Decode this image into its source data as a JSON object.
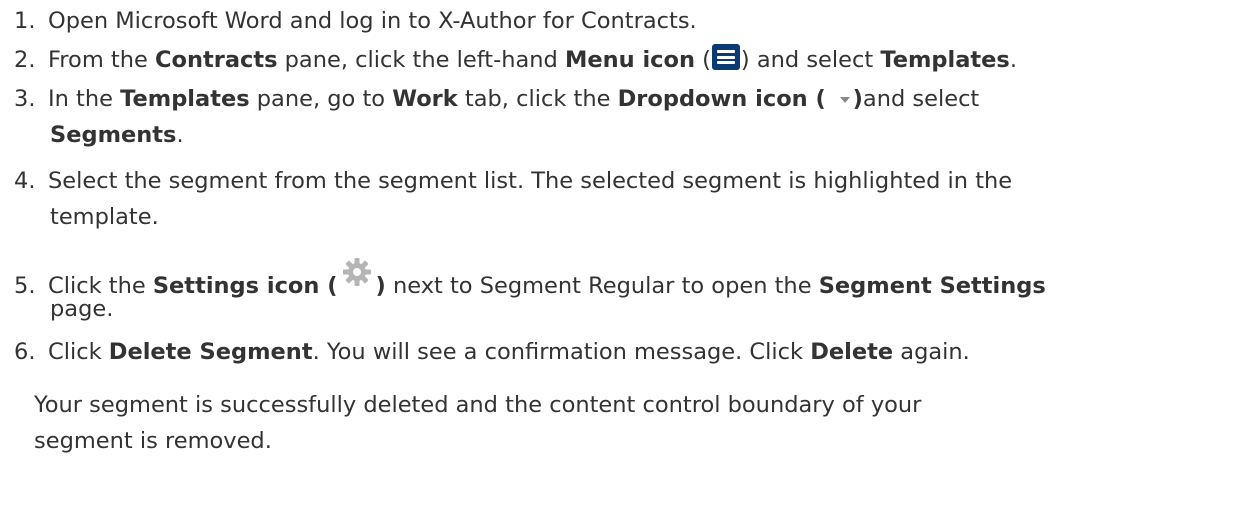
{
  "steps": [
    {
      "num": "1.",
      "text_a": "Open Microsoft Word and log in to X-Author for Contracts."
    },
    {
      "num": "2.",
      "t1": "From the ",
      "b1": "Contracts",
      "t2": " pane, click the left-hand ",
      "b2": "Menu icon",
      "t3": " (",
      "icon": "menu-icon",
      "t4": ") and select ",
      "b3": "Templates",
      "t5": "."
    },
    {
      "num": "3.",
      "t1": "In the ",
      "b1": "Templates",
      "t2": " pane, go to ",
      "b2": "Work",
      "t3": " tab, click the ",
      "b3": "Dropdown icon ( ",
      "icon": "caret-down-icon",
      "b4": ")",
      "t4": "and select",
      "b5": "Segments",
      "t5": "."
    },
    {
      "num": "4.",
      "line1": "Select the segment from the segment list. The selected segment is highlighted in the",
      "line2": "template."
    },
    {
      "num": "5.",
      "t1": "Click the ",
      "b1": "Settings icon (",
      "icon": "gear-icon",
      "b2": ")",
      "t2": " next to Segment Regular to open the ",
      "b3": "Segment Settings",
      "line2": "page."
    },
    {
      "num": "6.",
      "t1": "Click ",
      "b1": "Delete Segment",
      "t2": ". You will see a confirmation message. Click ",
      "b2": "Delete",
      "t3": " again."
    }
  ],
  "result": {
    "line1": "Your segment is successfully deleted and the content control boundary of your",
    "line2": "segment is removed."
  },
  "colors": {
    "text": "#333333",
    "menu_icon_bg": "#0b3b73",
    "gear_icon": "#b5b5b5"
  }
}
